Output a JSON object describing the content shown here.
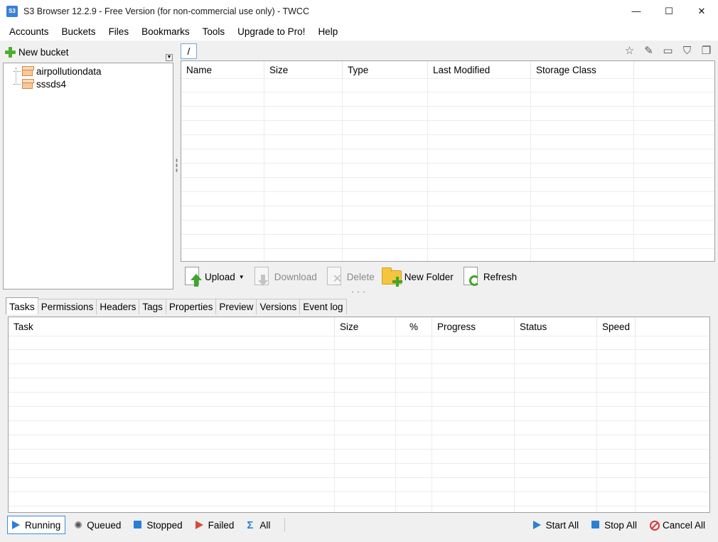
{
  "window": {
    "title": "S3 Browser 12.2.9 - Free Version (for non-commercial use only) - TWCC",
    "app_icon_label": "S3",
    "minimize": "—",
    "maximize": "☐",
    "close": "✕"
  },
  "menu": [
    "Accounts",
    "Buckets",
    "Files",
    "Bookmarks",
    "Tools",
    "Upgrade to Pro!",
    "Help"
  ],
  "left": {
    "new_bucket_label": "New bucket",
    "buckets": [
      "airpollutiondata",
      "sssds4"
    ]
  },
  "path": {
    "current": "/"
  },
  "right_tools": [
    "star-icon",
    "pencil-icon",
    "box-icon",
    "filter-icon",
    "copy-icon"
  ],
  "file_grid": {
    "columns": [
      "Name",
      "Size",
      "Type",
      "Last Modified",
      "Storage Class"
    ],
    "rows": []
  },
  "toolbar": {
    "upload": "Upload",
    "download": "Download",
    "delete": "Delete",
    "new_folder": "New Folder",
    "refresh": "Refresh"
  },
  "tabs": [
    "Tasks",
    "Permissions",
    "Headers",
    "Tags",
    "Properties",
    "Preview",
    "Versions",
    "Event log"
  ],
  "task_grid": {
    "columns": [
      "Task",
      "Size",
      "%",
      "Progress",
      "Status",
      "Speed"
    ],
    "rows": []
  },
  "bottom": {
    "running": "Running",
    "queued": "Queued",
    "stopped": "Stopped",
    "failed": "Failed",
    "all": "All",
    "start_all": "Start All",
    "stop_all": "Stop All",
    "cancel_all": "Cancel All"
  },
  "colors": {
    "accent": "#3a8de0",
    "green": "#3fa52b",
    "red": "#d94a3a"
  }
}
